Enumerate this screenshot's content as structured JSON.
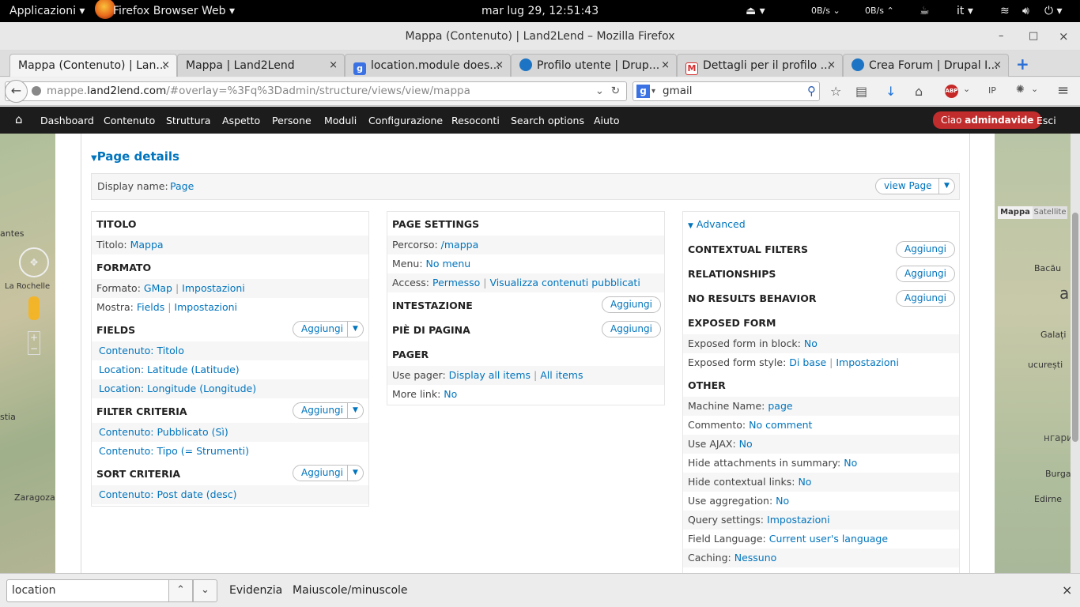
{
  "topbar": {
    "apps": "Applicazioni",
    "app_name": "Firefox Browser Web",
    "clock": "mar lug 29, 12:51:43",
    "net_down": "0B/s",
    "net_up": "0B/s",
    "lang": "it"
  },
  "window": {
    "title": "Mappa (Contenuto) | Land2Lend – Mozilla Firefox",
    "minimize": "–",
    "maximize": "□",
    "close": "×"
  },
  "tabs": [
    {
      "label": "Mappa (Contenuto) | Lan...",
      "icon": "drupal-icon",
      "icon_color": "#ffffff"
    },
    {
      "label": "Mappa | Land2Lend",
      "icon": "",
      "icon_color": ""
    },
    {
      "label": "location.module does...",
      "icon": "google-icon",
      "icon_color": "#3b72e3"
    },
    {
      "label": "Profilo utente | Drup...",
      "icon": "drupal-icon",
      "icon_color": "#1e74c4"
    },
    {
      "label": "Dettagli per il profilo ...",
      "icon": "gmail-icon",
      "icon_color": "#d32f2f"
    },
    {
      "label": "Crea Forum | Drupal I...",
      "icon": "drupal-icon",
      "icon_color": "#1e74c4"
    }
  ],
  "tab_close": "×",
  "new_tab": "+",
  "nav": {
    "url_prefix": "mappe.",
    "url_domain": "land2lend.com",
    "url_rest": "/#overlay=%3Fq%3Dadmin/structure/views/view/mappa",
    "search_value": "gmail"
  },
  "toolbar": {
    "home": "⌂",
    "items": [
      "Dashboard",
      "Contenuto",
      "Struttura",
      "Aspetto",
      "Persone",
      "Moduli",
      "Configurazione",
      "Resoconti",
      "Search options",
      "Aiuto"
    ],
    "hello_prefix": "Ciao ",
    "user": "admindavide",
    "logout": "Esci"
  },
  "map": {
    "left_labels": [
      "antes",
      "La Rochelle",
      "stia",
      "Zaragoza"
    ],
    "right_tabs": [
      "Mappa",
      "Satellite"
    ],
    "right_labels": [
      "Bacău",
      "a",
      "Galați",
      "ucurești",
      "нгария",
      "Burgas",
      "Edirne"
    ]
  },
  "view": {
    "section_title": "Page details",
    "display_name_label": "Display name:",
    "display_name_value": "Page",
    "view_page_button": "view Page",
    "left": {
      "titolo_header": "TITOLO",
      "titolo_label": "Titolo:",
      "titolo_value": "Mappa",
      "formato_header": "FORMATO",
      "formato_label": "Formato:",
      "formato_value": "GMap",
      "formato_settings": "Impostazioni",
      "mostra_label": "Mostra:",
      "mostra_value": "Fields",
      "mostra_settings": "Impostazioni",
      "fields_header": "FIELDS",
      "fields": [
        "Contenuto: Titolo",
        "Location: Latitude (Latitude)",
        "Location: Longitude (Longitude)"
      ],
      "filter_header": "FILTER CRITERIA",
      "filters": [
        "Contenuto: Pubblicato (Sì)",
        "Contenuto: Tipo (= Strumenti)"
      ],
      "sort_header": "SORT CRITERIA",
      "sorts": [
        "Contenuto: Post date (desc)"
      ],
      "add_label": "Aggiungi"
    },
    "middle": {
      "page_settings_header": "PAGE SETTINGS",
      "percorso_label": "Percorso:",
      "percorso_value": "/mappa",
      "menu_label": "Menu:",
      "menu_value": "No menu",
      "access_label": "Access:",
      "access_value": "Permesso",
      "access_value2": "Visualizza contenuti pubblicati",
      "intestazione_header": "INTESTAZIONE",
      "footer_header": "PIÈ DI PAGINA",
      "pager_header": "PAGER",
      "use_pager_label": "Use pager:",
      "use_pager_value": "Display all items",
      "use_pager_value2": "All items",
      "more_link_label": "More link:",
      "more_link_value": "No",
      "add_label": "Aggiungi"
    },
    "right": {
      "advanced": "Advanced",
      "contextual_header": "CONTEXTUAL FILTERS",
      "relationships_header": "RELATIONSHIPS",
      "noresults_header": "NO RESULTS BEHAVIOR",
      "add_label": "Aggiungi",
      "exposed_header": "EXPOSED FORM",
      "exposed_block_label": "Exposed form in block:",
      "exposed_block_value": "No",
      "exposed_style_label": "Exposed form style:",
      "exposed_style_value": "Di base",
      "exposed_style_settings": "Impostazioni",
      "other_header": "OTHER",
      "other": [
        {
          "label": "Machine Name:",
          "value": "page"
        },
        {
          "label": "Commento:",
          "value": "No comment"
        },
        {
          "label": "Use AJAX:",
          "value": "No"
        },
        {
          "label": "Hide attachments in summary:",
          "value": "No"
        },
        {
          "label": "Hide contextual links:",
          "value": "No"
        },
        {
          "label": "Use aggregation:",
          "value": "No"
        },
        {
          "label": "Query settings:",
          "value": "Impostazioni"
        },
        {
          "label": "Field Language:",
          "value": "Current user's language"
        },
        {
          "label": "Caching:",
          "value": "Nessuno"
        }
      ]
    }
  },
  "findbar": {
    "value": "location",
    "highlight": "Evidenzia",
    "match_case": "Maiuscole/minuscole",
    "close": "×"
  },
  "colors": {
    "link": "#0074bd",
    "toolbar_bg": "#1c1c1c",
    "hello_bg": "#c12c2c"
  }
}
